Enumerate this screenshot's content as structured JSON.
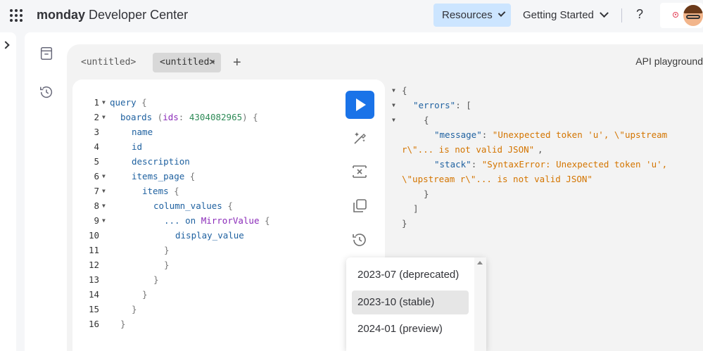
{
  "header": {
    "brand_bold": "monday",
    "brand_rest": "Developer Center",
    "resources_label": "Resources",
    "getting_started_label": "Getting Started",
    "help_label": "?"
  },
  "tabs": [
    {
      "label": "<untitled>"
    },
    {
      "label": "<untitled>",
      "active": true
    }
  ],
  "add_tab_label": "+",
  "close_tab_label": "×",
  "playground_label": "API playground",
  "query_lines": [
    {
      "n": "1",
      "fold": true
    },
    {
      "n": "2",
      "fold": true
    },
    {
      "n": "3",
      "fold": false
    },
    {
      "n": "4",
      "fold": false
    },
    {
      "n": "5",
      "fold": false
    },
    {
      "n": "6",
      "fold": true
    },
    {
      "n": "7",
      "fold": true
    },
    {
      "n": "8",
      "fold": true
    },
    {
      "n": "9",
      "fold": true
    },
    {
      "n": "10",
      "fold": false
    },
    {
      "n": "11",
      "fold": false
    },
    {
      "n": "12",
      "fold": false
    },
    {
      "n": "13",
      "fold": false
    },
    {
      "n": "14",
      "fold": false
    },
    {
      "n": "15",
      "fold": false
    },
    {
      "n": "16",
      "fold": false
    }
  ],
  "query_text": {
    "l1_kw": "query",
    "l1_br": " {",
    "l2_field": "boards",
    "l2_open": " (",
    "l2_arg": "ids",
    "l2_colon": ": ",
    "l2_val": "4304082965",
    "l2_close": ") {",
    "l3": "name",
    "l4": "id",
    "l5": "description",
    "l6_field": "items_page",
    "l6_br": " {",
    "l7_field": "items",
    "l7_br": " {",
    "l8_field": "column_values",
    "l8_br": " {",
    "l9_dots": "... on ",
    "l9_type": "MirrorValue",
    "l9_br": " {",
    "l10": "display_value",
    "close": "}"
  },
  "result": {
    "open": "{",
    "errors_key": "\"errors\"",
    "errors_open": ": [",
    "obj_open": "{",
    "message_key": "\"message\"",
    "message_val_1": "\"Unexpected token 'u', \\\"upstream",
    "message_val_2": "r\\\"... is not valid JSON\"",
    "stack_key": "\"stack\"",
    "stack_val_1": "\"SyntaxError: Unexpected token 'u',",
    "stack_val_2": "\\\"upstream r\\\"... is not valid JSON\"",
    "obj_close": "}",
    "arr_close": "]",
    "close": "}"
  },
  "version_options": [
    {
      "label": "2023-07 (deprecated)",
      "selected": false
    },
    {
      "label": "2023-10 (stable)",
      "selected": true
    },
    {
      "label": "2024-01 (preview)",
      "selected": false
    }
  ],
  "colors": {
    "accent": "#1a73e8",
    "resources_bg": "#cce5ff",
    "keyword": "#1f61a0",
    "argument": "#8b2bb9",
    "number": "#2e8b57",
    "string": "#d47500"
  }
}
